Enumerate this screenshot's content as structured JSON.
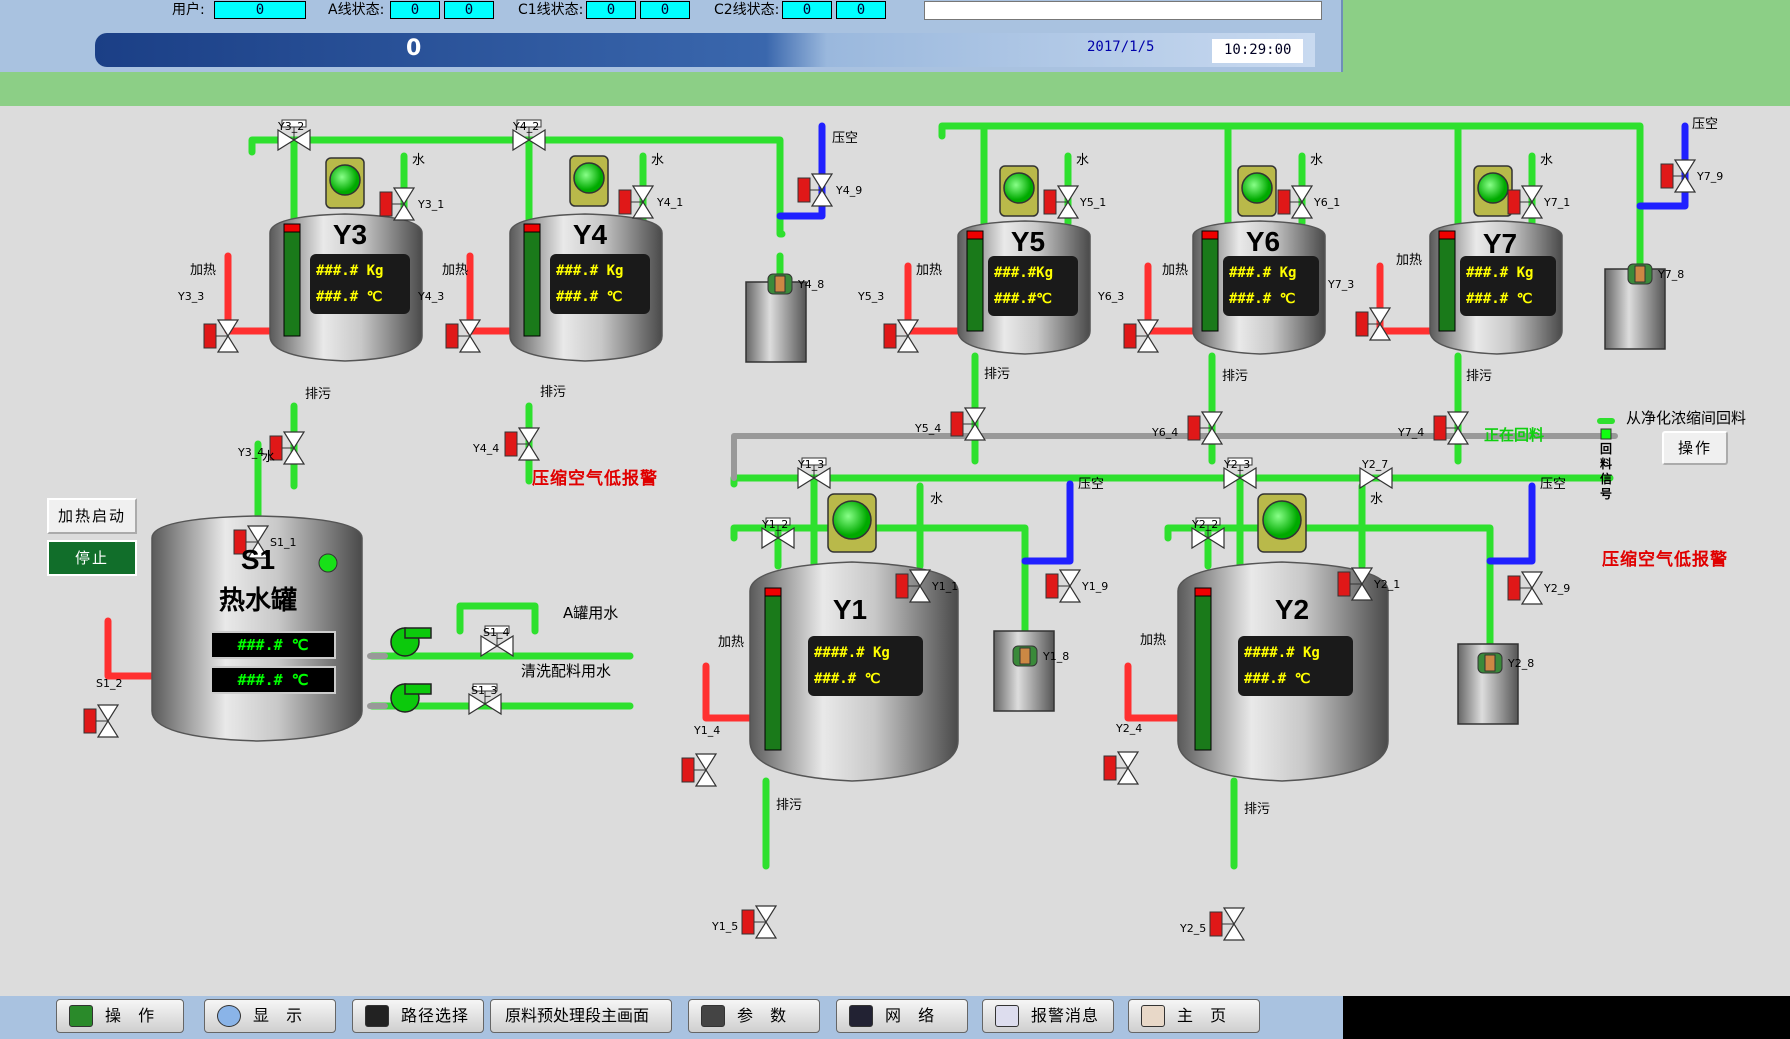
{
  "header": {
    "user_label": "用户:",
    "user_value": "0",
    "a_label": "A线状态:",
    "a_v1": "0",
    "a_v2": "0",
    "c1_label": "C1线状态:",
    "c1_v1": "0",
    "c1_v2": "0",
    "c2_label": "C2线状态:",
    "c2_v1": "0",
    "c2_v2": "0",
    "banner_value": "0",
    "date": "2017/1/5",
    "time": "10:29:00"
  },
  "tanks": {
    "y3": {
      "name": "Y3",
      "w": "###.# Kg",
      "t": "###.# ℃"
    },
    "y4": {
      "name": "Y4",
      "w": "###.# Kg",
      "t": "###.# ℃"
    },
    "y5": {
      "name": "Y5",
      "w": "###.#Kg",
      "t": "###.#℃"
    },
    "y6": {
      "name": "Y6",
      "w": "###.# Kg",
      "t": "###.# ℃"
    },
    "y7": {
      "name": "Y7",
      "w": "###.# Kg",
      "t": "###.# ℃"
    },
    "y1": {
      "name": "Y1",
      "w": "####.# Kg",
      "t": "###.# ℃"
    },
    "y2": {
      "name": "Y2",
      "w": "####.# Kg",
      "t": "###.# ℃"
    },
    "s1": {
      "name": "S1",
      "sub": "热水罐",
      "t1": "###.# ℃",
      "t2": "###.# ℃"
    }
  },
  "labels": {
    "water": "水",
    "heat": "加热",
    "drain": "排污",
    "air": "压空",
    "a_water": "A罐用水",
    "wash_water": "清洗配料用水",
    "from_clean": "从净化浓缩间回料",
    "returning": "正在回料",
    "return_signal": "回料信号",
    "alarm": "压缩空气低报警"
  },
  "valves": [
    "Y3_2",
    "Y4_2",
    "Y3_1",
    "Y4_1",
    "Y4_9",
    "Y3_3",
    "Y4_3",
    "Y4_8",
    "Y3_4",
    "Y4_4",
    "Y5_1",
    "Y6_1",
    "Y7_1",
    "Y7_9",
    "Y7_8",
    "Y5_3",
    "Y6_3",
    "Y7_3",
    "Y5_4",
    "Y6_4",
    "Y7_4",
    "Y1_3",
    "Y2_3",
    "Y2_7",
    "Y1_2",
    "Y2_2",
    "Y1_1",
    "Y2_1",
    "Y1_9",
    "Y2_9",
    "Y1_8",
    "Y2_8",
    "Y1_4",
    "Y2_4",
    "Y1_5",
    "Y2_5",
    "S1_1",
    "S1_2",
    "S1_3",
    "S1_4"
  ],
  "buttons": {
    "heat_start": "加热启动",
    "stop": "停止",
    "operate": "操作"
  },
  "nav": [
    {
      "label": "操 作"
    },
    {
      "label": "显 示"
    },
    {
      "label": "路径选择"
    },
    {
      "label": "原料预处理段主画面"
    },
    {
      "label": "参 数"
    },
    {
      "label": "网 络"
    },
    {
      "label": "报警消息"
    },
    {
      "label": "主 页"
    }
  ]
}
